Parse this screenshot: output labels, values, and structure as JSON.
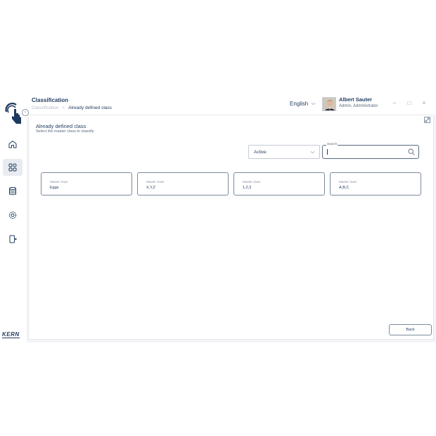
{
  "header": {
    "title": "Classification",
    "breadcrumb": {
      "root": "Classification",
      "separator": ">",
      "current": "Already defined class"
    },
    "language": "English",
    "user": {
      "name": "Albert Sauter",
      "role": "Admin, Administrator"
    },
    "window_controls": {
      "minimize": "–",
      "maximize": "□",
      "close": "×"
    }
  },
  "sidebar": {
    "collapse_glyph": "›",
    "items": [
      {
        "icon": "home-icon",
        "active": false
      },
      {
        "icon": "grid-icon",
        "active": true
      },
      {
        "icon": "database-icon",
        "active": false
      },
      {
        "icon": "gear-icon",
        "active": false
      },
      {
        "icon": "logout-icon",
        "active": false
      }
    ],
    "brand": "KERN"
  },
  "main": {
    "title": "Already defined class",
    "subtitle": "Select the master class to classify",
    "status_filter": {
      "value": "Active"
    },
    "search": {
      "label": "Search",
      "value": ""
    },
    "cards": [
      {
        "label": "Master class",
        "value": "Eggs"
      },
      {
        "label": "Master class",
        "value": "X,Y,Z"
      },
      {
        "label": "Master class",
        "value": "1,2,3"
      },
      {
        "label": "Master class",
        "value": "A,B,C"
      }
    ],
    "back_label": "Back"
  },
  "colors": {
    "primary": "#1f3a5f",
    "muted": "#596a80",
    "border": "#7a8aa0",
    "background": "#f4f5f7"
  }
}
